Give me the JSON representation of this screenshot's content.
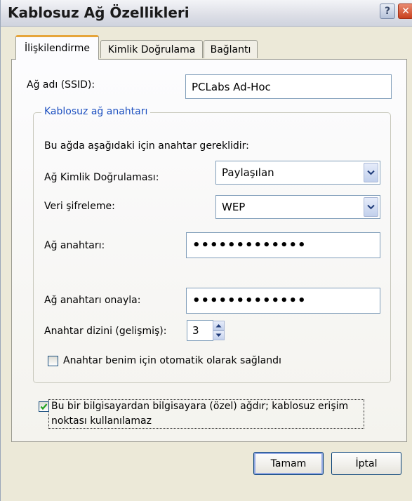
{
  "window": {
    "title": "Kablosuz Ağ Özellikleri",
    "help_glyph": "?",
    "close_glyph": "✕"
  },
  "tabs": [
    {
      "label": "İlişkilendirme",
      "active": true
    },
    {
      "label": "Kimlik Doğrulama",
      "active": false
    },
    {
      "label": "Bağlantı",
      "active": false
    }
  ],
  "association": {
    "ssid_label": "Ağ adı (SSID):",
    "ssid_value": "PCLabs Ad-Hoc",
    "group_title": "Kablosuz ağ anahtarı",
    "requirement_text": "Bu ağda aşağıdaki için anahtar gereklidir:",
    "auth_label": "Ağ Kimlik Doğrulaması:",
    "auth_value": "Paylaşılan",
    "encryption_label": "Veri şifreleme:",
    "encryption_value": "WEP",
    "key_label": "Ağ anahtarı:",
    "key_value": "•••••••••••••",
    "confirm_label": "Ağ anahtarı onayla:",
    "confirm_value": "•••••••••••••",
    "key_index_label": "Anahtar dizini (gelişmiş):",
    "key_index_value": "3",
    "auto_key_label": "Anahtar benim için otomatik olarak sağlandı",
    "auto_key_checked": false,
    "adhoc_label_line1": "Bu bir bilgisayardan bilgisayara (özel) ağdır; kablosuz erişim",
    "adhoc_label_line2": "noktası kullanılamaz",
    "adhoc_checked": true
  },
  "buttons": {
    "ok": "Tamam",
    "cancel": "İptal"
  },
  "colors": {
    "accent_tab": "#e6a53a",
    "group_title": "#1c4fc0",
    "close_button": "#c8401e",
    "check_mark": "#21a121"
  },
  "icons": {
    "help": "help-icon",
    "close": "close-icon",
    "dropdown": "chevron-down-icon",
    "spin_up": "spin-up-icon",
    "spin_down": "spin-down-icon",
    "check": "check-icon"
  }
}
